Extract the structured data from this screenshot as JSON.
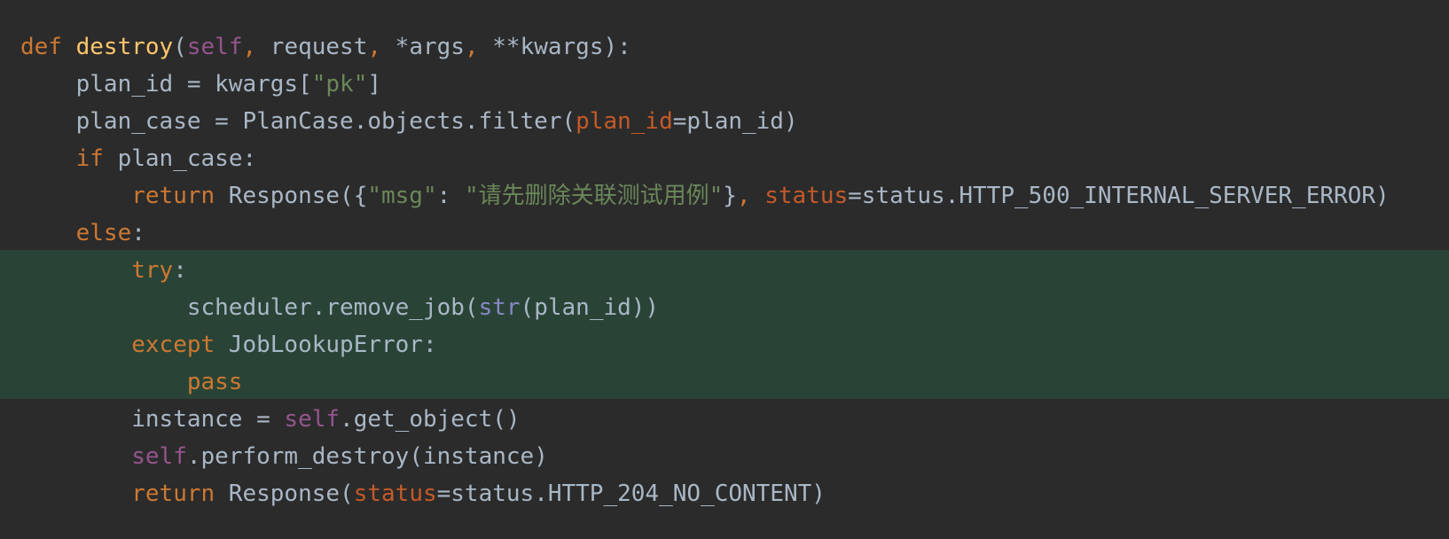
{
  "colors": {
    "background": "#2b2b2b",
    "highlight": "#294436",
    "keyword": "#cc7832",
    "function_name": "#ffc66d",
    "self": "#94558d",
    "string": "#6a8759",
    "named_arg": "#c45a28",
    "builtin": "#8888c6",
    "default_text": "#a9b7c6"
  },
  "code": {
    "lines": [
      {
        "indent": "",
        "tokens": [
          {
            "t": "def",
            "c": "kw"
          },
          {
            "t": " ",
            "c": ""
          },
          {
            "t": "destroy",
            "c": "fn"
          },
          {
            "t": "(",
            "c": ""
          },
          {
            "t": "self",
            "c": "self"
          },
          {
            "t": ",",
            "c": "kw"
          },
          {
            "t": " request",
            "c": ""
          },
          {
            "t": ",",
            "c": "kw"
          },
          {
            "t": " *args",
            "c": ""
          },
          {
            "t": ",",
            "c": "kw"
          },
          {
            "t": " **kwargs):",
            "c": ""
          }
        ]
      },
      {
        "indent": "    ",
        "tokens": [
          {
            "t": "plan_id = kwargs[",
            "c": ""
          },
          {
            "t": "\"pk\"",
            "c": "str"
          },
          {
            "t": "]",
            "c": ""
          }
        ]
      },
      {
        "indent": "    ",
        "tokens": [
          {
            "t": "plan_case = PlanCase.objects.filter(",
            "c": ""
          },
          {
            "t": "plan_id",
            "c": "param"
          },
          {
            "t": "=plan_id)",
            "c": ""
          }
        ]
      },
      {
        "indent": "    ",
        "tokens": [
          {
            "t": "if",
            "c": "kw"
          },
          {
            "t": " plan_case:",
            "c": ""
          }
        ]
      },
      {
        "indent": "        ",
        "tokens": [
          {
            "t": "return",
            "c": "kw"
          },
          {
            "t": " Response({",
            "c": ""
          },
          {
            "t": "\"msg\"",
            "c": "str"
          },
          {
            "t": ": ",
            "c": ""
          },
          {
            "t": "\"请先删除关联测试用例\"",
            "c": "str"
          },
          {
            "t": "}",
            "c": ""
          },
          {
            "t": ",",
            "c": "kw"
          },
          {
            "t": " ",
            "c": ""
          },
          {
            "t": "status",
            "c": "param"
          },
          {
            "t": "=status.HTTP_500_INTERNAL_SERVER_ERROR)",
            "c": ""
          }
        ]
      },
      {
        "indent": "    ",
        "tokens": [
          {
            "t": "else",
            "c": "kw"
          },
          {
            "t": ":",
            "c": ""
          }
        ]
      },
      {
        "indent": "        ",
        "tokens": [
          {
            "t": "try",
            "c": "kw"
          },
          {
            "t": ":",
            "c": ""
          }
        ]
      },
      {
        "indent": "            ",
        "tokens": [
          {
            "t": "scheduler.remove_job(",
            "c": ""
          },
          {
            "t": "str",
            "c": "builtin"
          },
          {
            "t": "(plan_id))",
            "c": ""
          }
        ]
      },
      {
        "indent": "        ",
        "tokens": [
          {
            "t": "except",
            "c": "kw"
          },
          {
            "t": " JobLookupError:",
            "c": ""
          }
        ]
      },
      {
        "indent": "            ",
        "tokens": [
          {
            "t": "pass",
            "c": "kw"
          }
        ]
      },
      {
        "indent": "        ",
        "tokens": [
          {
            "t": "instance = ",
            "c": ""
          },
          {
            "t": "self",
            "c": "self"
          },
          {
            "t": ".get_object()",
            "c": ""
          }
        ]
      },
      {
        "indent": "        ",
        "tokens": [
          {
            "t": "self",
            "c": "self"
          },
          {
            "t": ".perform_destroy(instance)",
            "c": ""
          }
        ]
      },
      {
        "indent": "        ",
        "tokens": [
          {
            "t": "return",
            "c": "kw"
          },
          {
            "t": " Response(",
            "c": ""
          },
          {
            "t": "status",
            "c": "param"
          },
          {
            "t": "=status.HTTP_204_NO_CONTENT)",
            "c": ""
          }
        ]
      }
    ]
  }
}
